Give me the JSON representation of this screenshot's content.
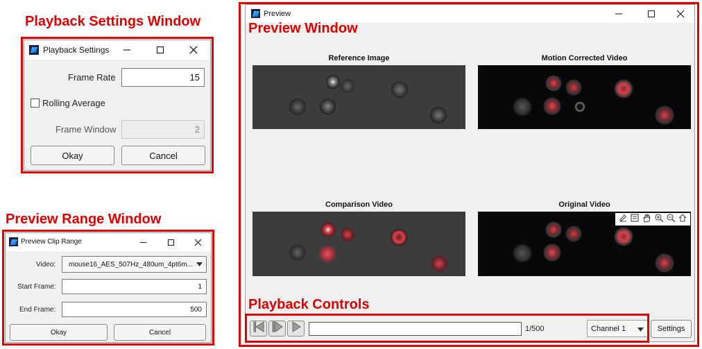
{
  "annotations": {
    "playback_settings": "Playback Settings Window",
    "preview_range": "Preview Range Window",
    "preview_window": "Preview Window",
    "playback_controls": "Playback Controls"
  },
  "playback_settings": {
    "title": "Playback Settings",
    "frame_rate_label": "Frame Rate",
    "frame_rate_value": "15",
    "rolling_average_label": "Rolling Average",
    "rolling_average_checked": false,
    "frame_window_label": "Frame Window",
    "frame_window_value": "2",
    "okay": "Okay",
    "cancel": "Cancel"
  },
  "preview_range": {
    "title": "Preview Clip Range",
    "video_label": "Video:",
    "video_value": "mouse16_AES_507Hz_480um_4pt6m...",
    "start_label": "Start Frame:",
    "start_value": "1",
    "end_label": "End Frame:",
    "end_value": "500",
    "okay": "Okay",
    "cancel": "Cancel"
  },
  "preview": {
    "title": "Preview",
    "plots": {
      "reference": "Reference Image",
      "motion_corrected": "Motion Corrected Video",
      "comparison": "Comparison Video",
      "original": "Original Video"
    },
    "toolbar_icons": [
      "annotate-icon",
      "data-tip-icon",
      "pan-hand-icon",
      "zoom-in-icon",
      "zoom-out-icon",
      "home-icon"
    ],
    "controls": {
      "frame_counter": "1/500",
      "channel": "Channel 1",
      "settings": "Settings"
    }
  },
  "colors": {
    "annotation_red": "#e00000",
    "window_bg": "#f0f0f0",
    "overlay_red": "#e0404a"
  }
}
